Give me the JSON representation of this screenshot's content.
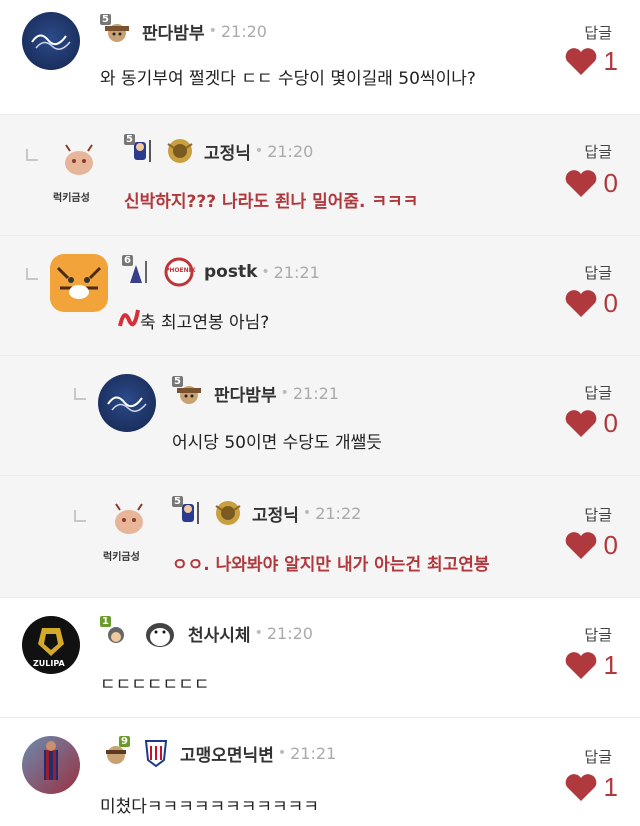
{
  "reply_label": "답글",
  "heart_color": "#b0393e",
  "comments": [
    {
      "level": "5",
      "nick": "판다밤부",
      "time": "21:20",
      "text": "와 동기부여 쩔겟다 ㄷㄷ 수당이 몇이길래 50씩이나?",
      "likes": "1"
    },
    {
      "level": "5",
      "nick": "고정닉",
      "time": "21:20",
      "text": "신박하지??? 나라도 죈나 밀어줌. ㅋㅋㅋ",
      "likes": "0",
      "avatar_text": "럭키금성"
    },
    {
      "level": "6",
      "nick": "postk",
      "time": "21:21",
      "text": "축 최고연봉 아님?",
      "likes": "0",
      "team_text": "PHOENIX"
    },
    {
      "level": "5",
      "nick": "판다밤부",
      "time": "21:21",
      "text": "어시당 50이면 수당도 개쌜듯",
      "likes": "0"
    },
    {
      "level": "5",
      "nick": "고정닉",
      "time": "21:22",
      "text": "ㅇㅇ. 나와봐야 알지만 내가 아는건 최고연봉",
      "likes": "0",
      "avatar_text": "럭키금성"
    },
    {
      "level": "1",
      "nick": "천사시체",
      "time": "21:20",
      "text": "ㄷㄷㄷㄷㄷㄷㄷ",
      "likes": "1",
      "avatar_text": "ZULIPA"
    },
    {
      "level": "9",
      "nick": "고맹오면닉변",
      "time": "21:21",
      "text": "미쳤다ㅋㅋㅋㅋㅋㅋㅋㅋㅋㅋㅋ",
      "likes": "1"
    }
  ]
}
